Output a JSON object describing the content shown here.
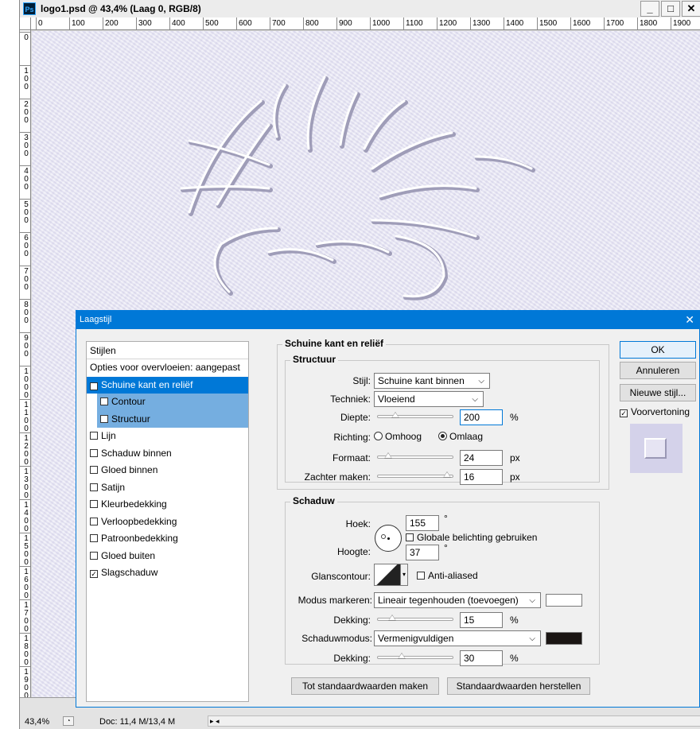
{
  "window": {
    "title": "logo1.psd @ 43,4% (Laag 0, RGB/8)",
    "buttons": [
      "_",
      "□",
      "✕"
    ]
  },
  "rulers": {
    "horizontal": [
      "0",
      "100",
      "200",
      "300",
      "400",
      "500",
      "600",
      "700",
      "800",
      "900",
      "1000",
      "1100",
      "1200",
      "1300",
      "1400",
      "1500",
      "1600",
      "1700",
      "1800",
      "1900"
    ],
    "vertical": [
      "0",
      "100",
      "200",
      "300",
      "400",
      "500",
      "600",
      "700",
      "800",
      "900",
      "1000",
      "1100",
      "1200",
      "1300",
      "1400",
      "1500",
      "1600",
      "1700",
      "1800",
      "1900"
    ]
  },
  "status": {
    "zoom": "43,4%",
    "doc": "Doc: 11,4 M/13,4 M"
  },
  "dialog": {
    "title": "Laagstijl",
    "left_panel": {
      "header": "Stijlen",
      "blend_options": "Opties voor overvloeien: aangepast",
      "items": [
        {
          "label": "Schuine kant en reliëf",
          "checked": true,
          "selected": true
        },
        {
          "label": "Contour",
          "checked": false,
          "sub": true
        },
        {
          "label": "Structuur",
          "checked": false,
          "sub": true
        },
        {
          "label": "Lijn",
          "checked": false
        },
        {
          "label": "Schaduw binnen",
          "checked": false
        },
        {
          "label": "Gloed binnen",
          "checked": false
        },
        {
          "label": "Satijn",
          "checked": false
        },
        {
          "label": "Kleurbedekking",
          "checked": false
        },
        {
          "label": "Verloopbedekking",
          "checked": false
        },
        {
          "label": "Patroonbedekking",
          "checked": false
        },
        {
          "label": "Gloed buiten",
          "checked": false
        },
        {
          "label": "Slagschaduw",
          "checked": true
        }
      ]
    },
    "bevel": {
      "group_title": "Schuine kant en reliëf",
      "structure_title": "Structuur",
      "style_label": "Stijl:",
      "style_value": "Schuine kant binnen",
      "technique_label": "Techniek:",
      "technique_value": "Vloeiend",
      "depth_label": "Diepte:",
      "depth_value": "200",
      "depth_unit": "%",
      "depth_level": 0.2,
      "direction_label": "Richting:",
      "direction_up": "Omhoog",
      "direction_down": "Omlaag",
      "size_label": "Formaat:",
      "size_value": "24",
      "size_unit": "px",
      "size_level": 0.1,
      "soften_label": "Zachter maken:",
      "soften_value": "16",
      "soften_unit": "px",
      "soften_level": 0.98
    },
    "shading": {
      "group_title": "Schaduw",
      "angle_label": "Hoek:",
      "angle_value": "155",
      "angle_unit": "°",
      "global_light_label": "Globale belichting gebruiken",
      "altitude_label": "Hoogte:",
      "altitude_value": "37",
      "altitude_unit": "°",
      "gloss_label": "Glanscontour:",
      "antialias_label": "Anti-aliased",
      "highlight_mode_label": "Modus markeren:",
      "highlight_mode_value": "Lineair tegenhouden (toevoegen)",
      "highlight_color": "#ffffff",
      "highlight_opacity_label": "Dekking:",
      "highlight_opacity_value": "15",
      "highlight_opacity_unit": "%",
      "highlight_opacity_level": 0.15,
      "shadow_mode_label": "Schaduwmodus:",
      "shadow_mode_value": "Vermenigvuldigen",
      "shadow_color": "#1a1513",
      "shadow_opacity_label": "Dekking:",
      "shadow_opacity_value": "30",
      "shadow_opacity_unit": "%",
      "shadow_opacity_level": 0.3
    },
    "buttons": {
      "make_default": "Tot standaardwaarden maken",
      "reset_default": "Standaardwaarden herstellen",
      "ok": "OK",
      "cancel": "Annuleren",
      "new_style": "Nieuwe stijl...",
      "preview": "Voorvertoning"
    }
  }
}
